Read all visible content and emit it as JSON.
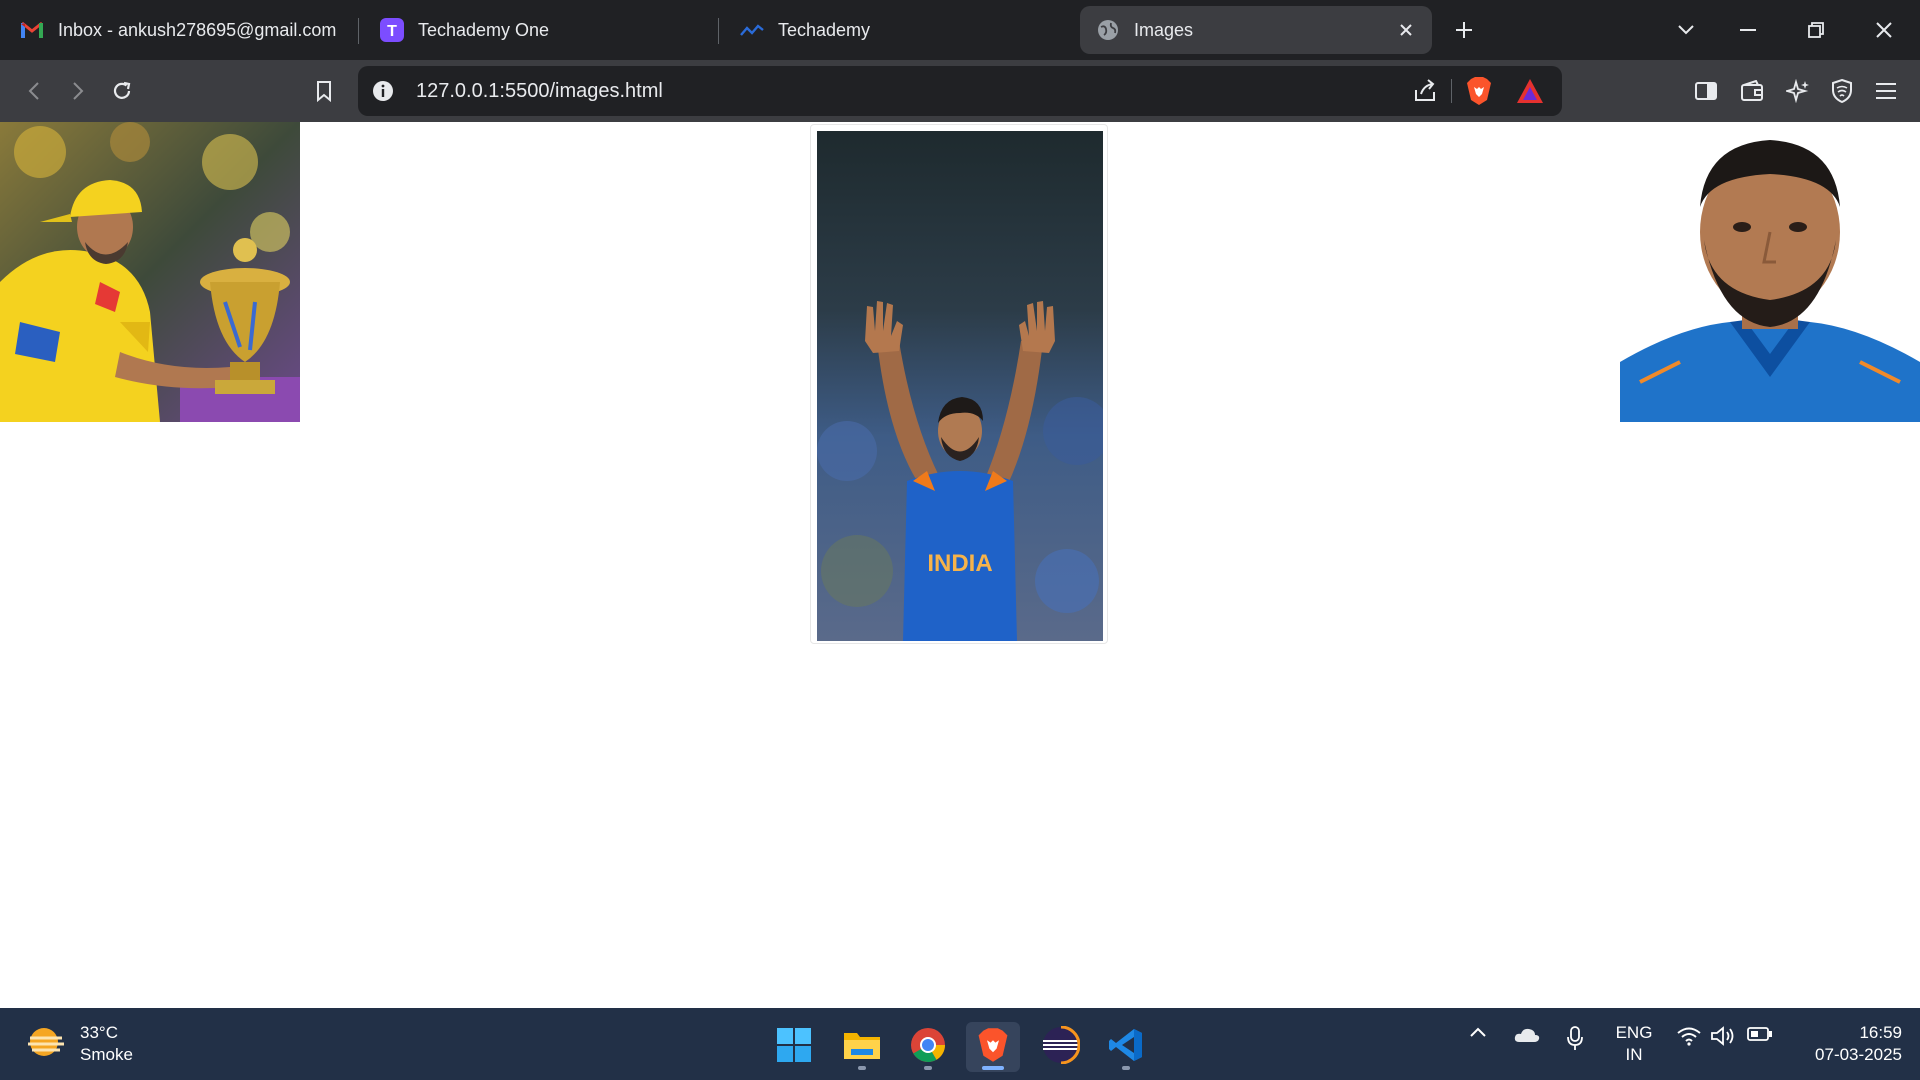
{
  "browser": {
    "tabs": [
      {
        "title": "Inbox - ankush278695@gmail.com",
        "icon": "gmail-icon"
      },
      {
        "title": "Techademy One",
        "icon": "techademy-one-icon"
      },
      {
        "title": "Techademy",
        "icon": "techademy-icon"
      },
      {
        "title": "Images",
        "icon": "globe-icon",
        "active": true
      }
    ],
    "url": "127.0.0.1:5500/images.html"
  },
  "page": {
    "images": [
      {
        "alt": "Cricketer in yellow jersey holding trophy"
      },
      {
        "alt": "Cricketer in India jersey raising both hands"
      },
      {
        "alt": "Portrait of cricketer in blue India jersey"
      }
    ]
  },
  "taskbar": {
    "weather": {
      "temp": "33°C",
      "condition": "Smoke"
    },
    "language": {
      "line1": "ENG",
      "line2": "IN"
    },
    "clock": {
      "time": "16:59",
      "date": "07-03-2025"
    }
  },
  "colors": {
    "tabstrip": "#202124",
    "toolbar": "#3c3d41",
    "taskbar": "#223047",
    "brave_orange": "#fb542b"
  }
}
